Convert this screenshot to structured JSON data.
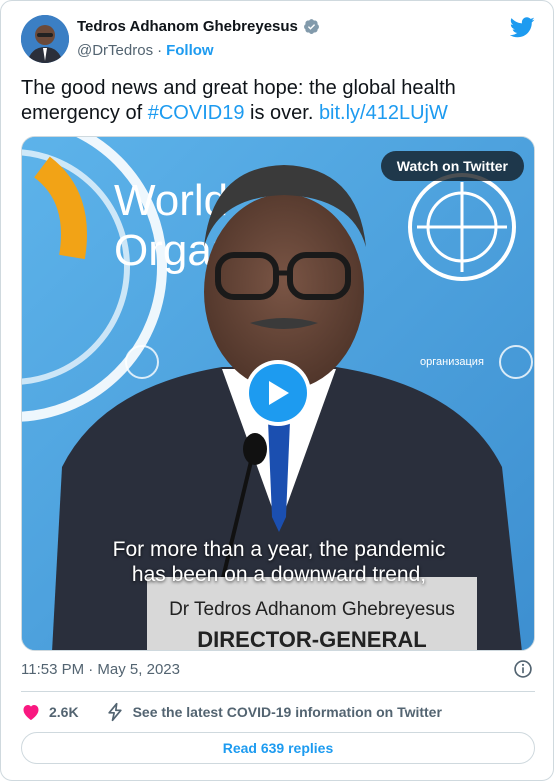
{
  "author": {
    "name": "Tedros Adhanom Ghebreyesus",
    "handle": "@DrTedros",
    "separator": "·",
    "follow_label": "Follow"
  },
  "tweet": {
    "text_before": "The good news and great hope: the global health emergency of ",
    "hashtag": "#COVID19",
    "text_middle": " is over. ",
    "link": "bit.ly/412LUjW"
  },
  "media": {
    "watch_label": "Watch on Twitter",
    "backdrop_text_1": "World",
    "backdrop_text_2": "Organ",
    "backdrop_text_3": "организация",
    "subtitle_line1": "For more than a year, the pandemic",
    "subtitle_line2": "has been on a downward trend,",
    "nameplate_line1": "Dr Tedros Adhanom Ghebreyesus",
    "nameplate_line2": "DIRECTOR-GENERAL"
  },
  "footer": {
    "timestamp": "11:53 PM · May 5, 2023",
    "like_count": "2.6K",
    "covid_info": "See the latest COVID-19 information on Twitter",
    "replies_label": "Read 639 replies"
  },
  "colors": {
    "twitter_blue": "#1d9bf0",
    "like_pink": "#f91880",
    "text_secondary": "#536471",
    "who_blue": "#4aa3e0"
  },
  "icons": [
    "verified-badge-icon",
    "twitter-bird-icon",
    "play-icon",
    "info-icon",
    "heart-icon",
    "lightning-icon"
  ]
}
